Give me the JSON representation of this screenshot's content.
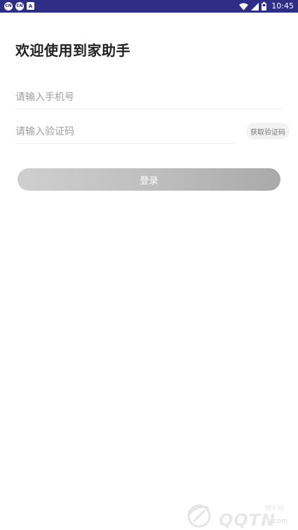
{
  "status_bar": {
    "notif_1": "CN",
    "notif_2": "CN",
    "notif_3": "A",
    "time": "10:45",
    "icons": [
      "wifi-icon",
      "signal-icon",
      "battery-icon"
    ],
    "background": "#2f2e86"
  },
  "page": {
    "title": "欢迎使用到家助手"
  },
  "form": {
    "phone_placeholder": "请输入手机号",
    "code_placeholder": "请输入验证码",
    "get_code_label": "获取验证码",
    "login_label": "登录"
  },
  "watermark": {
    "cn_text": "腾牛网",
    "brand_text": "QQTN",
    "suffix": ".com",
    "icon": "watermark-logo-icon"
  },
  "colors": {
    "title": "#222222",
    "placeholder": "#9e9e9e",
    "login_gradient_start": "#cfcfcf",
    "login_gradient_end": "#a9a9a9"
  }
}
